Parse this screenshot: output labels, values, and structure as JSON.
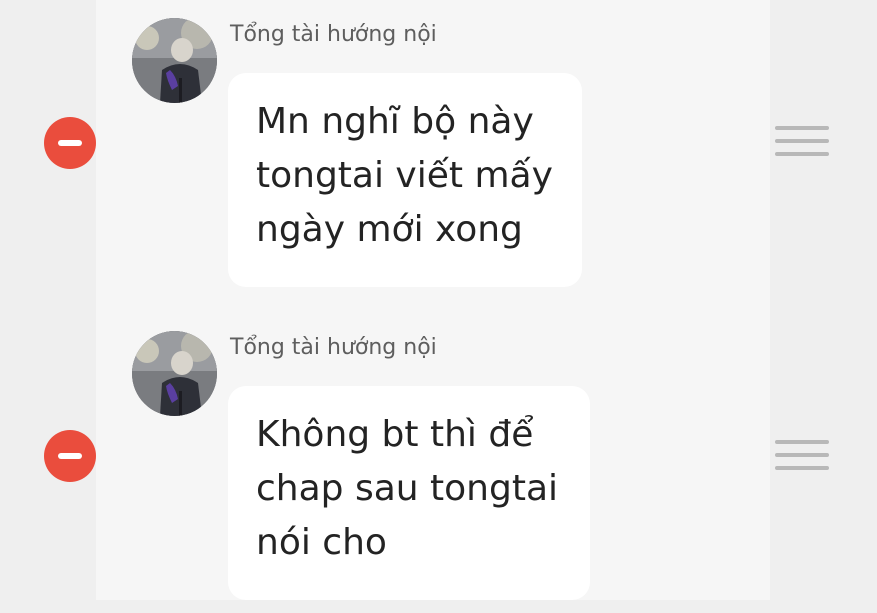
{
  "messages": [
    {
      "sender": "Tổng tài hướng nội",
      "lines": [
        "Mn nghĩ bộ này",
        "tongtai viết mấy",
        "ngày mới xong"
      ],
      "avatar_icon": "user-avatar-photo",
      "delete_icon": "minus-circle-icon",
      "handle_icon": "drag-handle-icon"
    },
    {
      "sender": "Tổng tài hướng nội",
      "lines": [
        "Không bt thì để",
        "chap sau tongtai",
        "nói cho"
      ],
      "avatar_icon": "user-avatar-photo",
      "delete_icon": "minus-circle-icon",
      "handle_icon": "drag-handle-icon"
    }
  ],
  "colors": {
    "delete": "#ea4d3d",
    "bubble": "#ffffff",
    "background": "#f6f6f6",
    "handle": "#b8b8b8",
    "text": "#232323",
    "sender": "#5e5e5e"
  }
}
